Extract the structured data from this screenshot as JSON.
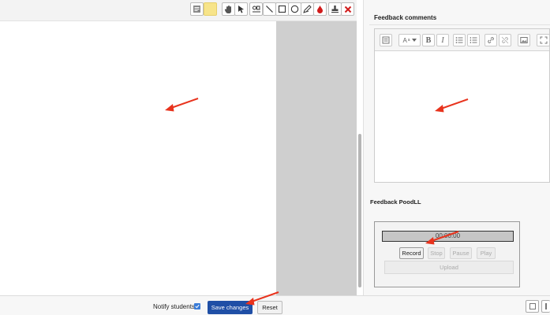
{
  "feedback_comments": {
    "title": "Feedback comments",
    "font_size_label": "A"
  },
  "feedback_poodll": {
    "title": "Feedback PoodLL",
    "timer": "00:00:00",
    "buttons": {
      "record": "Record",
      "stop": "Stop",
      "pause": "Pause",
      "play": "Play",
      "upload": "Upload"
    }
  },
  "footer": {
    "notify_students_label": "Notify students",
    "notify_students_checked": true,
    "save_label": "Save changes",
    "reset_label": "Reset"
  },
  "colors": {
    "primary_button": "#1f4fa6",
    "annotation_arrow": "#e8331d",
    "highlighter_yellow": "#f7e48a",
    "delete_red": "#d11b1b"
  },
  "toolbar_icons": [
    "comment-icon",
    "highlighter-yellow-icon",
    "hand-pan-icon",
    "select-pointer-icon",
    "stamp-text-icon",
    "line-icon",
    "rectangle-icon",
    "oval-icon",
    "pen-icon",
    "ink-color-icon",
    "stamp-icon",
    "delete-icon"
  ]
}
